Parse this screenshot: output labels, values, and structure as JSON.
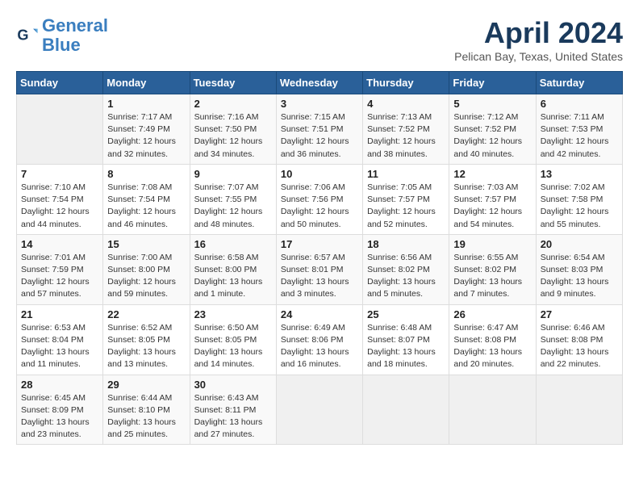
{
  "logo": {
    "line1": "General",
    "line2": "Blue"
  },
  "title": "April 2024",
  "subtitle": "Pelican Bay, Texas, United States",
  "days_of_week": [
    "Sunday",
    "Monday",
    "Tuesday",
    "Wednesday",
    "Thursday",
    "Friday",
    "Saturday"
  ],
  "weeks": [
    [
      {
        "day": "",
        "info": ""
      },
      {
        "day": "1",
        "info": "Sunrise: 7:17 AM\nSunset: 7:49 PM\nDaylight: 12 hours\nand 32 minutes."
      },
      {
        "day": "2",
        "info": "Sunrise: 7:16 AM\nSunset: 7:50 PM\nDaylight: 12 hours\nand 34 minutes."
      },
      {
        "day": "3",
        "info": "Sunrise: 7:15 AM\nSunset: 7:51 PM\nDaylight: 12 hours\nand 36 minutes."
      },
      {
        "day": "4",
        "info": "Sunrise: 7:13 AM\nSunset: 7:52 PM\nDaylight: 12 hours\nand 38 minutes."
      },
      {
        "day": "5",
        "info": "Sunrise: 7:12 AM\nSunset: 7:52 PM\nDaylight: 12 hours\nand 40 minutes."
      },
      {
        "day": "6",
        "info": "Sunrise: 7:11 AM\nSunset: 7:53 PM\nDaylight: 12 hours\nand 42 minutes."
      }
    ],
    [
      {
        "day": "7",
        "info": "Sunrise: 7:10 AM\nSunset: 7:54 PM\nDaylight: 12 hours\nand 44 minutes."
      },
      {
        "day": "8",
        "info": "Sunrise: 7:08 AM\nSunset: 7:54 PM\nDaylight: 12 hours\nand 46 minutes."
      },
      {
        "day": "9",
        "info": "Sunrise: 7:07 AM\nSunset: 7:55 PM\nDaylight: 12 hours\nand 48 minutes."
      },
      {
        "day": "10",
        "info": "Sunrise: 7:06 AM\nSunset: 7:56 PM\nDaylight: 12 hours\nand 50 minutes."
      },
      {
        "day": "11",
        "info": "Sunrise: 7:05 AM\nSunset: 7:57 PM\nDaylight: 12 hours\nand 52 minutes."
      },
      {
        "day": "12",
        "info": "Sunrise: 7:03 AM\nSunset: 7:57 PM\nDaylight: 12 hours\nand 54 minutes."
      },
      {
        "day": "13",
        "info": "Sunrise: 7:02 AM\nSunset: 7:58 PM\nDaylight: 12 hours\nand 55 minutes."
      }
    ],
    [
      {
        "day": "14",
        "info": "Sunrise: 7:01 AM\nSunset: 7:59 PM\nDaylight: 12 hours\nand 57 minutes."
      },
      {
        "day": "15",
        "info": "Sunrise: 7:00 AM\nSunset: 8:00 PM\nDaylight: 12 hours\nand 59 minutes."
      },
      {
        "day": "16",
        "info": "Sunrise: 6:58 AM\nSunset: 8:00 PM\nDaylight: 13 hours\nand 1 minute."
      },
      {
        "day": "17",
        "info": "Sunrise: 6:57 AM\nSunset: 8:01 PM\nDaylight: 13 hours\nand 3 minutes."
      },
      {
        "day": "18",
        "info": "Sunrise: 6:56 AM\nSunset: 8:02 PM\nDaylight: 13 hours\nand 5 minutes."
      },
      {
        "day": "19",
        "info": "Sunrise: 6:55 AM\nSunset: 8:02 PM\nDaylight: 13 hours\nand 7 minutes."
      },
      {
        "day": "20",
        "info": "Sunrise: 6:54 AM\nSunset: 8:03 PM\nDaylight: 13 hours\nand 9 minutes."
      }
    ],
    [
      {
        "day": "21",
        "info": "Sunrise: 6:53 AM\nSunset: 8:04 PM\nDaylight: 13 hours\nand 11 minutes."
      },
      {
        "day": "22",
        "info": "Sunrise: 6:52 AM\nSunset: 8:05 PM\nDaylight: 13 hours\nand 13 minutes."
      },
      {
        "day": "23",
        "info": "Sunrise: 6:50 AM\nSunset: 8:05 PM\nDaylight: 13 hours\nand 14 minutes."
      },
      {
        "day": "24",
        "info": "Sunrise: 6:49 AM\nSunset: 8:06 PM\nDaylight: 13 hours\nand 16 minutes."
      },
      {
        "day": "25",
        "info": "Sunrise: 6:48 AM\nSunset: 8:07 PM\nDaylight: 13 hours\nand 18 minutes."
      },
      {
        "day": "26",
        "info": "Sunrise: 6:47 AM\nSunset: 8:08 PM\nDaylight: 13 hours\nand 20 minutes."
      },
      {
        "day": "27",
        "info": "Sunrise: 6:46 AM\nSunset: 8:08 PM\nDaylight: 13 hours\nand 22 minutes."
      }
    ],
    [
      {
        "day": "28",
        "info": "Sunrise: 6:45 AM\nSunset: 8:09 PM\nDaylight: 13 hours\nand 23 minutes."
      },
      {
        "day": "29",
        "info": "Sunrise: 6:44 AM\nSunset: 8:10 PM\nDaylight: 13 hours\nand 25 minutes."
      },
      {
        "day": "30",
        "info": "Sunrise: 6:43 AM\nSunset: 8:11 PM\nDaylight: 13 hours\nand 27 minutes."
      },
      {
        "day": "",
        "info": ""
      },
      {
        "day": "",
        "info": ""
      },
      {
        "day": "",
        "info": ""
      },
      {
        "day": "",
        "info": ""
      }
    ]
  ]
}
